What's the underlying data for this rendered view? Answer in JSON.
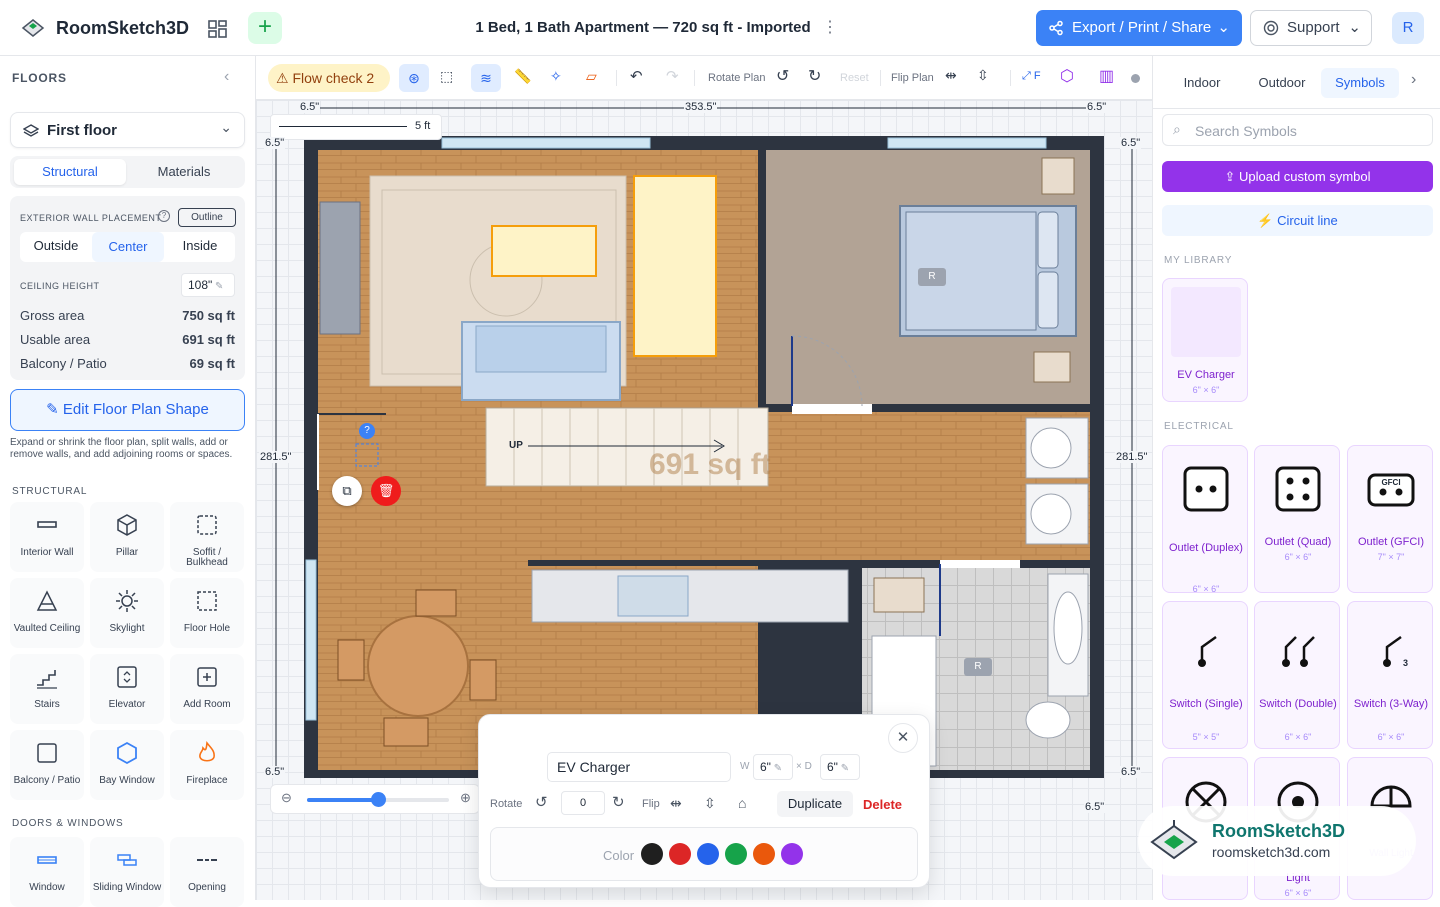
{
  "app": {
    "name": "RoomSketch3D",
    "doc_title": "1 Bed, 1 Bath Apartment — 720 sq ft - Imported",
    "export_label": "Export / Print / Share",
    "support_label": "Support",
    "avatar_letter": "R"
  },
  "colors": {
    "accent": "#3b82f6",
    "upload": "#9333ea",
    "delete": "#dc2626",
    "floor_wood": "#c8935a",
    "wall": "#2d3440"
  },
  "left": {
    "header": "FLOORS",
    "floor": "First floor",
    "tabs": [
      "Structural",
      "Materials"
    ],
    "wall_placement_label": "EXTERIOR WALL PLACEMENT",
    "outline_label": "Outline",
    "placement_options": [
      "Outside",
      "Center",
      "Inside"
    ],
    "ceiling_label": "CEILING HEIGHT",
    "ceiling_value": "108\"",
    "gross_label": "Gross area",
    "gross_value": "750 sq ft",
    "usable_label": "Usable area",
    "usable_value": "691 sq ft",
    "balcony_label": "Balcony / Patio",
    "balcony_value": "69 sq ft",
    "edit_label": "Edit Floor Plan Shape",
    "edit_help": "Expand or shrink the floor plan, split walls, add or remove walls, and add adjoining rooms or spaces.",
    "structural_header": "STRUCTURAL",
    "structural_items": [
      "Interior Wall",
      "Pillar",
      "Soffit / Bulkhead",
      "Vaulted Ceiling",
      "Skylight",
      "Floor Hole",
      "Stairs",
      "Elevator",
      "Add Room",
      "Balcony / Patio",
      "Bay Window",
      "Fireplace"
    ],
    "doors_header": "DOORS & WINDOWS",
    "door_items": [
      "Window",
      "Sliding Window",
      "Opening"
    ]
  },
  "toolbar": {
    "flow_check": "Flow check 2",
    "rotate_plan": "Rotate Plan",
    "reset": "Reset",
    "flip_plan": "Flip Plan",
    "fit": "F"
  },
  "canvas": {
    "scale_label": "5 ft",
    "dims": {
      "top_left": "6.5\"",
      "top_mid": "353.5\"",
      "top_right": "6.5\"",
      "left_top": "6.5\"",
      "left_mid": "281.5\"",
      "left_bot": "6.5\"",
      "right_top": "6.5\"",
      "right_mid": "281.5\"",
      "right_bot": "6.5\"",
      "bottom_right": "6.5\""
    },
    "stairs_label": "UP",
    "area_watermark": "691 sq ft",
    "bed_tag": "R",
    "bath_tag": "R",
    "selected_marker": "?"
  },
  "dialog": {
    "name": "EV Charger",
    "w_label": "W",
    "w_value": "6\"",
    "d_label": "× D",
    "d_value": "6\"",
    "rotate_label": "Rotate",
    "rotate_value": "0",
    "flip_label": "Flip",
    "duplicate": "Duplicate",
    "delete": "Delete",
    "color_label": "Color",
    "colors": [
      "#1f1f1f",
      "#dc2626",
      "#2563eb",
      "#16a34a",
      "#ea580c",
      "#9333ea"
    ]
  },
  "right": {
    "tabs": [
      "Indoor",
      "Outdoor",
      "Symbols"
    ],
    "search_placeholder": "Search Symbols",
    "upload_label": "Upload custom symbol",
    "circuit_label": "Circuit line",
    "library_header": "MY LIBRARY",
    "library_item": {
      "name": "EV Charger",
      "size": "6\" × 6\""
    },
    "electrical_header": "ELECTRICAL",
    "electrical": [
      {
        "name": "Outlet (Duplex)",
        "size": "6\" × 6\""
      },
      {
        "name": "Outlet (Quad)",
        "size": "6\" × 6\""
      },
      {
        "name": "Outlet (GFCI)",
        "size": "7\" × 7\""
      },
      {
        "name": "Switch (Single)",
        "size": "5\" × 5\""
      },
      {
        "name": "Switch (Double)",
        "size": "6\" × 6\""
      },
      {
        "name": "Switch (3-Way)",
        "size": "6\" × 6\""
      }
    ],
    "partial_items": [
      "Light",
      "Wall Light"
    ],
    "partial_size": "6\" × 6\"",
    "gfci_text": "GFCI",
    "three_text": "3"
  },
  "watermark": {
    "name": "RoomSketch3D",
    "url": "roomsketch3d.com"
  }
}
